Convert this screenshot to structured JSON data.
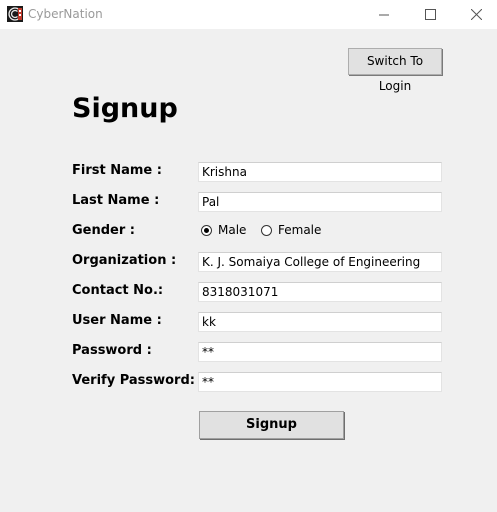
{
  "window": {
    "title": "CyberNation",
    "icon": "cybernation-logo-icon"
  },
  "toolbar": {
    "switch_label": "Switch To Login"
  },
  "form": {
    "heading": "Signup",
    "fields": [
      {
        "label": "First Name :",
        "value": "Krishna"
      },
      {
        "label": "Last Name :",
        "value": "Pal"
      },
      {
        "label": "Organization :",
        "value": "K. J. Somaiya College of Engineering"
      },
      {
        "label": "Contact No.:",
        "value": "8318031071"
      },
      {
        "label": "User Name :",
        "value": "kk"
      },
      {
        "label": "Password :",
        "value": "**"
      },
      {
        "label": "Verify Password:",
        "value": "**"
      }
    ],
    "gender": {
      "label": "Gender :",
      "options": [
        {
          "label": "Male",
          "selected": true
        },
        {
          "label": "Female",
          "selected": false
        }
      ]
    },
    "submit_label": "Signup"
  }
}
